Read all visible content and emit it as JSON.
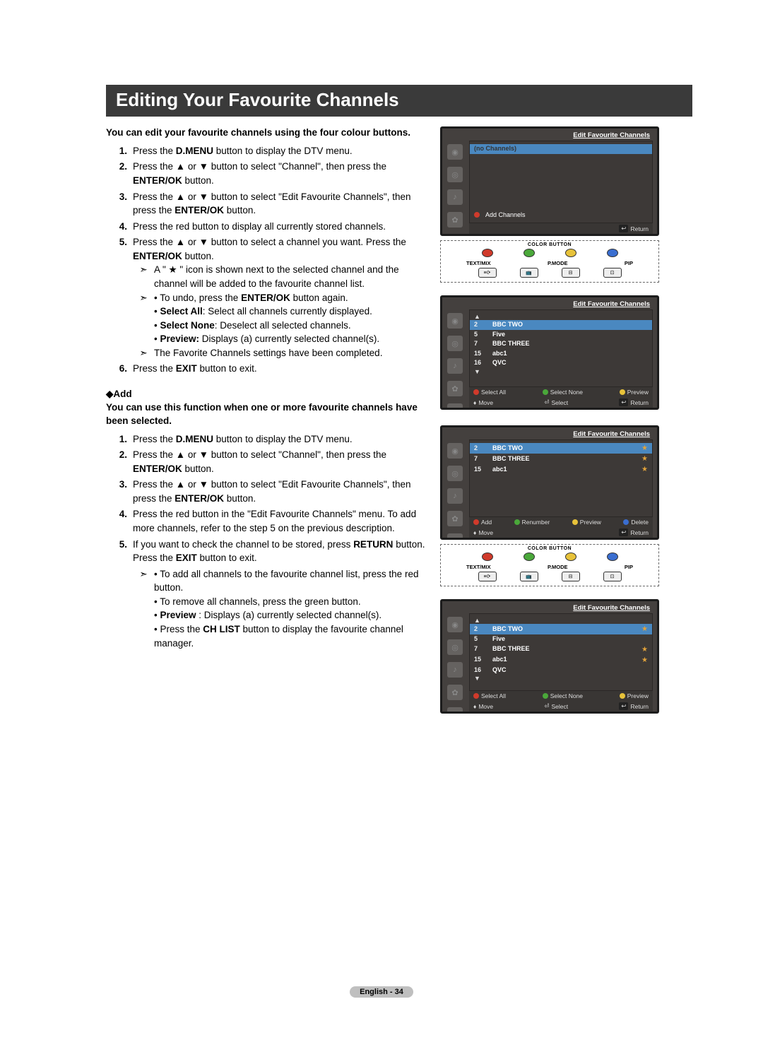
{
  "title": "Editing Your Favourite Channels",
  "intro1": "You can edit your favourite channels using the four colour buttons.",
  "steps1": {
    "s1": {
      "n": "1.",
      "t": "Press the <b>D.MENU</b> button to display the DTV menu."
    },
    "s2": {
      "n": "2.",
      "t": "Press the ▲ or ▼ button to select \"Channel\", then press the <b>ENTER/OK</b> button."
    },
    "s3": {
      "n": "3.",
      "t": "Press the ▲ or ▼ button to select \"Edit Favourite Channels\", then press the <b>ENTER/OK</b> button."
    },
    "s4": {
      "n": "4.",
      "t": "Press the red button to display all currently stored channels."
    },
    "s5": {
      "n": "5.",
      "t": "Press the ▲ or ▼ button to select a channel you want. Press the <b>ENTER/OK</b> button."
    },
    "s5a": "A \" ★ \" icon is shown next to the selected channel and the channel will be added to the favourite channel list.",
    "s5b1": "• To undo, press the <b>ENTER/OK</b> button again.",
    "s5b2": "• <b>Select All</b>: Select all channels currently displayed.",
    "s5b3": "• <b>Select None</b>: Deselect all selected channels.",
    "s5b4": "• <b>Preview:</b> Displays (a) currently selected channel(s).",
    "s5c": "The Favorite Channels settings have been completed.",
    "s6": {
      "n": "6.",
      "t": "Press the <b>EXIT</b> button to exit."
    }
  },
  "addHead": "◆Add",
  "intro2": "You can use this function when one or more favourite channels have been selected.",
  "steps2": {
    "s1": {
      "n": "1.",
      "t": "Press the <b>D.MENU</b> button to display the DTV menu."
    },
    "s2": {
      "n": "2.",
      "t": "Press the ▲ or ▼ button to select \"Channel\", then press the <b>ENTER/OK</b> button."
    },
    "s3": {
      "n": "3.",
      "t": "Press the ▲ or ▼ button to select \"Edit Favourite Channels\", then press the <b>ENTER/OK</b> button."
    },
    "s4": {
      "n": "4.",
      "t": "Press the red button in the \"Edit Favourite Channels\" menu. To add more channels, refer to the step 5 on the previous description."
    },
    "s5": {
      "n": "5.",
      "t": "If you want to check the channel to be stored, press <b>RETURN</b> button.<br>Press the <b>EXIT</b> button to exit."
    },
    "n1": "• To add all channels to the favourite channel list, press the red button.",
    "n2": "• To remove all channels, press the green button.",
    "n3": "• <b>Preview</b> : Displays (a) currently selected channel(s).",
    "n4": "• Press the <b>CH LIST</b> button to display the favourite channel manager."
  },
  "osd": {
    "title": "Edit Favourite Channels",
    "noChannels": "(no Channels)",
    "addChannels": "Add Channels",
    "return": "Return",
    "move": "Move",
    "select": "Select",
    "selectAll": "Select All",
    "selectNone": "Select None",
    "preview": "Preview",
    "add": "Add",
    "renumber": "Renumber",
    "delete": "Delete",
    "ch": [
      {
        "n": "2",
        "name": "BBC TWO"
      },
      {
        "n": "5",
        "name": "Five"
      },
      {
        "n": "7",
        "name": "BBC THREE"
      },
      {
        "n": "15",
        "name": "abc1"
      },
      {
        "n": "16",
        "name": "QVC"
      }
    ],
    "ch3": [
      {
        "n": "2",
        "name": "BBC TWO",
        "star": true
      },
      {
        "n": "7",
        "name": "BBC THREE",
        "star": true
      },
      {
        "n": "15",
        "name": "abc1",
        "star": true
      }
    ],
    "ch4": [
      {
        "n": "2",
        "name": "BBC TWO",
        "star": true
      },
      {
        "n": "5",
        "name": "Five"
      },
      {
        "n": "7",
        "name": "BBC THREE",
        "star": true
      },
      {
        "n": "15",
        "name": "abc1",
        "star": true
      },
      {
        "n": "16",
        "name": "QVC"
      }
    ]
  },
  "remote": {
    "hdr": "COLOR BUTTON",
    "l1": "TEXT/MIX",
    "l2": "P.MODE",
    "l3": "PIP"
  },
  "footer": "English - 34"
}
